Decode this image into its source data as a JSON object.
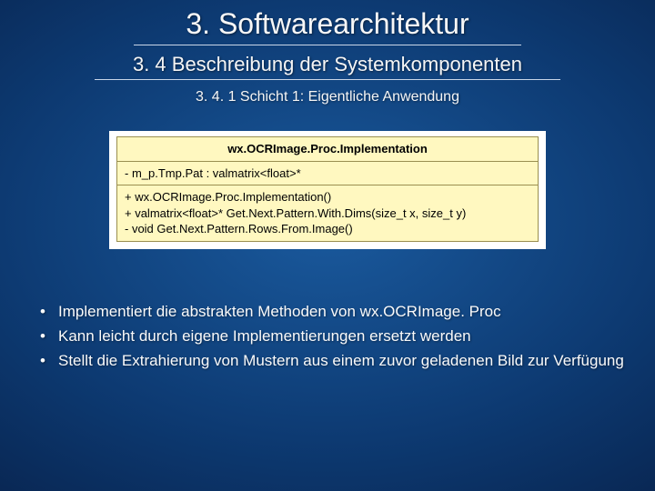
{
  "title": "3. Softwarearchitektur",
  "subtitle": "3. 4 Beschreibung der Systemkomponenten",
  "subsection": "3. 4. 1 Schicht 1: Eigentliche Anwendung",
  "classbox": {
    "name": "wx.OCRImage.Proc.Implementation",
    "attributes": "- m_p.Tmp.Pat : valmatrix<float>*",
    "operations": "+ wx.OCRImage.Proc.Implementation()\n+ valmatrix<float>* Get.Next.Pattern.With.Dims(size_t x, size_t y)\n- void Get.Next.Pattern.Rows.From.Image()"
  },
  "bullets": [
    "Implementiert die abstrakten Methoden von wx.OCRImage. Proc",
    "Kann leicht durch eigene Implementierungen ersetzt werden",
    "Stellt die Extrahierung von Mustern aus einem zuvor geladenen Bild zur Verfügung"
  ]
}
